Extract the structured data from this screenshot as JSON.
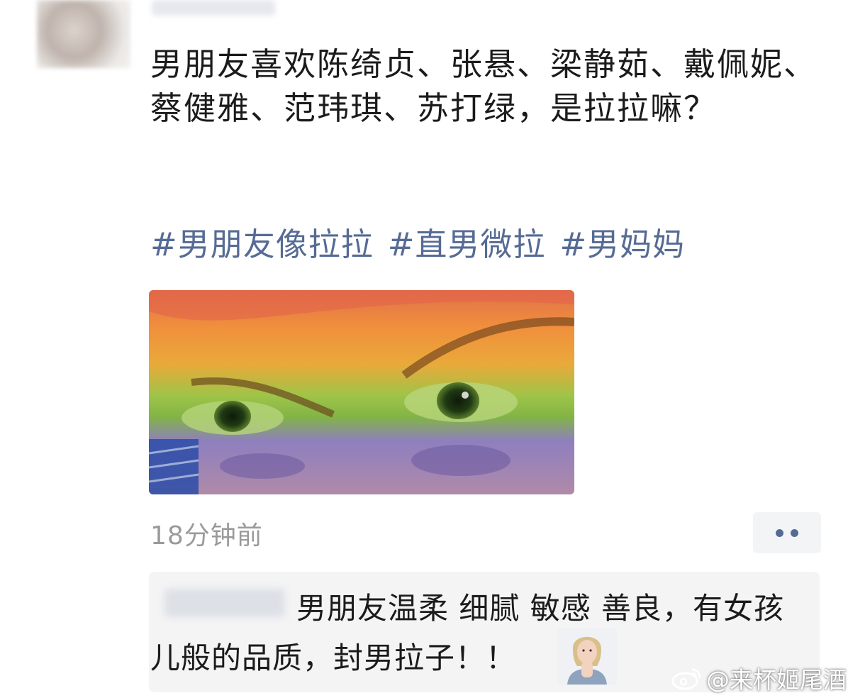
{
  "post": {
    "text": "男朋友喜欢陈绮贞、张悬、梁静茹、戴佩妮、蔡健雅、范玮琪、苏打绿，是拉拉嘛？",
    "hashtags": [
      "#男朋友像拉拉",
      "#直男微拉",
      "#男妈妈"
    ],
    "image_icon": "rainbow-eyes-photo",
    "time": "18分钟前",
    "more_icon": "more-dots-icon"
  },
  "comment": {
    "text": "男朋友温柔 细腻 敏感 善良，有女孩儿般的品质，封男拉子！！",
    "emoji_icon": "thinking-woman-sticker"
  },
  "watermark": {
    "logo_icon": "weibo-logo-icon",
    "text": "@来杯姬尾酒"
  },
  "colors": {
    "hashtag": "#566b94",
    "time": "#9a9a9a",
    "comment_bg": "#f4f4f5"
  }
}
